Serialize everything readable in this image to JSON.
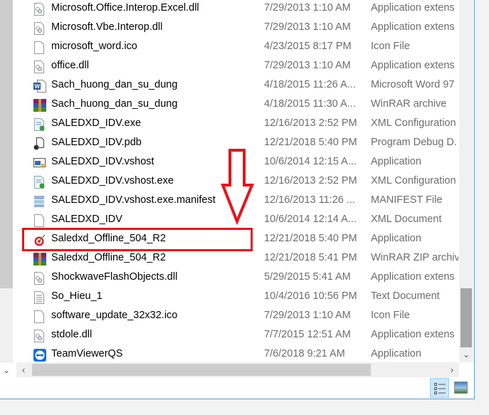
{
  "files": [
    {
      "name": "Microsoft.Office.Interop.Excel.dll",
      "date": "7/29/2013 1:10 AM",
      "type": "Application extens",
      "icon": "dll-icon"
    },
    {
      "name": "Microsoft.Vbe.Interop.dll",
      "date": "7/29/2013 1:10 AM",
      "type": "Application extens",
      "icon": "dll-icon"
    },
    {
      "name": "microsoft_word.ico",
      "date": "4/23/2015 8:17 PM",
      "type": "Icon File",
      "icon": "blank-file-icon"
    },
    {
      "name": "office.dll",
      "date": "7/29/2013 1:10 AM",
      "type": "Application extens",
      "icon": "dll-icon"
    },
    {
      "name": "Sach_huong_dan_su_dung",
      "date": "4/18/2015 11:26 A...",
      "type": "Microsoft Word 97",
      "icon": "word-icon"
    },
    {
      "name": "Sach_huong_dan_su_dung",
      "date": "4/18/2015 11:30 A...",
      "type": "WinRAR archive",
      "icon": "winrar-icon"
    },
    {
      "name": "SALEDXD_IDV.exe",
      "date": "12/16/2013 2:52 PM",
      "type": "XML Configuration",
      "icon": "config-icon"
    },
    {
      "name": "SALEDXD_IDV.pdb",
      "date": "12/21/2018 5:40 PM",
      "type": "Program Debug D.",
      "icon": "pdb-icon"
    },
    {
      "name": "SALEDXD_IDV.vshost",
      "date": "10/6/2014 12:15 A...",
      "type": "Application",
      "icon": "vshost-icon"
    },
    {
      "name": "SALEDXD_IDV.vshost.exe",
      "date": "12/16/2013 2:52 PM",
      "type": "XML Configuration",
      "icon": "config-icon"
    },
    {
      "name": "SALEDXD_IDV.vshost.exe.manifest",
      "date": "12/16/2013 11:26 ...",
      "type": "MANIFEST File",
      "icon": "manifest-icon"
    },
    {
      "name": "SALEDXD_IDV",
      "date": "10/6/2014 12:14 A...",
      "type": "XML Document",
      "icon": "blank-file-icon"
    },
    {
      "name": "Saledxd_Offline_504_R2",
      "date": "12/21/2018 5:40 PM",
      "type": "Application",
      "icon": "target-icon"
    },
    {
      "name": "Saledxd_Offline_504_R2",
      "date": "12/21/2018 5:41 PM",
      "type": "WinRAR ZIP archive",
      "icon": "winrar-icon"
    },
    {
      "name": "ShockwaveFlashObjects.dll",
      "date": "5/29/2015 5:41 AM",
      "type": "Application extens",
      "icon": "dll-icon"
    },
    {
      "name": "So_Hieu_1",
      "date": "10/4/2016 10:56 PM",
      "type": "Text Document",
      "icon": "text-file-icon"
    },
    {
      "name": "software_update_32x32.ico",
      "date": "7/29/2013 1:10 AM",
      "type": "Icon File",
      "icon": "blank-file-icon"
    },
    {
      "name": "stdole.dll",
      "date": "7/7/2015 12:51 AM",
      "type": "Application extens",
      "icon": "dll-icon"
    },
    {
      "name": "TeamViewerQS",
      "date": "7/6/2018 9:21 AM",
      "type": "Application",
      "icon": "teamviewer-icon"
    }
  ],
  "highlight_color": "#e8141c",
  "highlighted_file": "Saledxd_Offline_504_R2"
}
